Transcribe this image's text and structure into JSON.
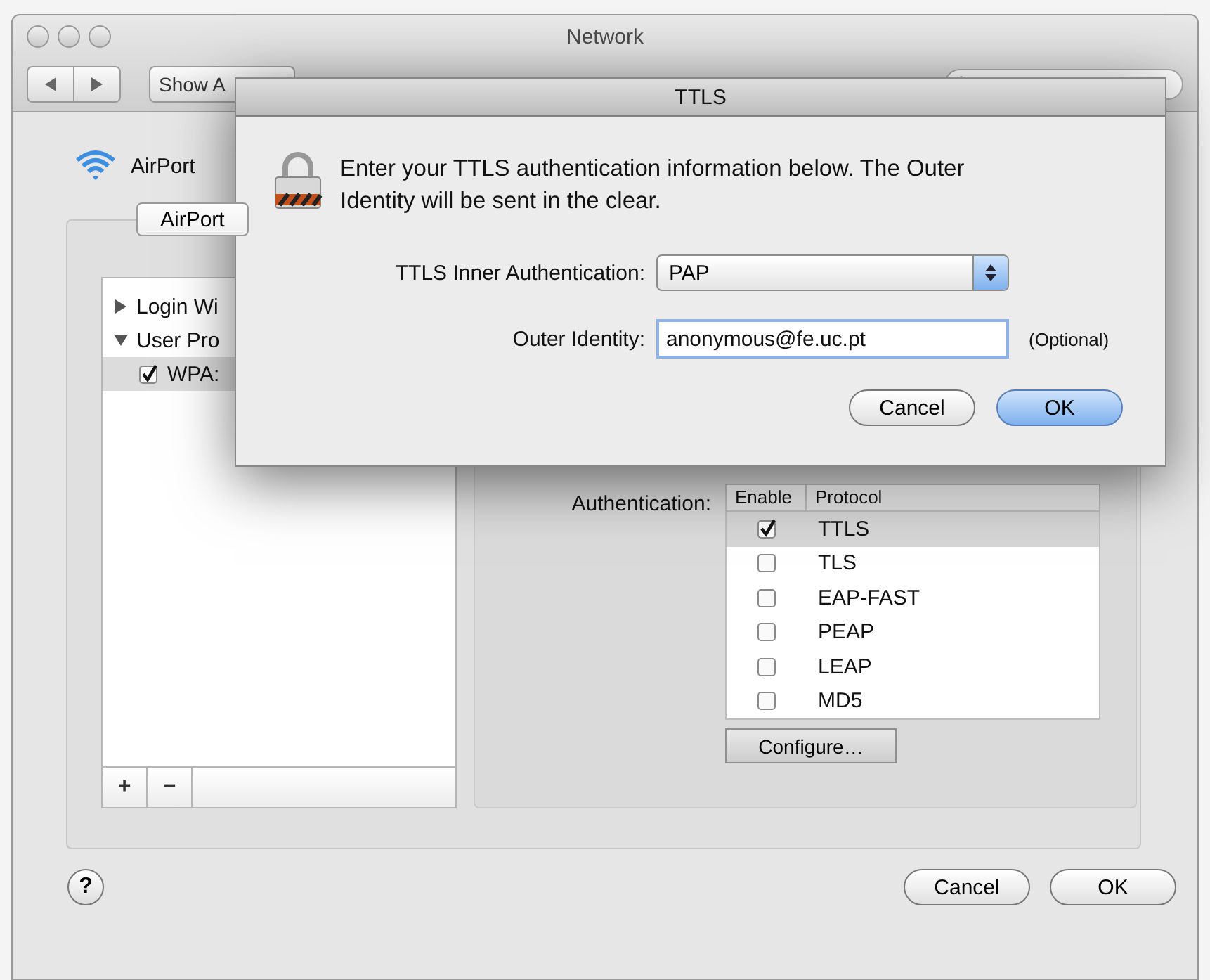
{
  "window": {
    "title": "Network"
  },
  "toolbar": {
    "show_all_button": "Show A"
  },
  "sheet": {
    "service": "AirPort",
    "tabs": [
      {
        "label": "AirPort",
        "selected": true
      }
    ],
    "profiles": [
      {
        "label": "Login Wi",
        "expanded": false
      },
      {
        "label": "User Pro",
        "expanded": true,
        "children": [
          {
            "label": "WPA:",
            "checked": true,
            "selected": true
          }
        ]
      }
    ],
    "list_buttons": [
      "+",
      "−"
    ],
    "authentication": {
      "label": "Authentication:",
      "columns": [
        "Enable",
        "Protocol"
      ],
      "rows": [
        {
          "protocol": "TTLS",
          "checked": true,
          "selected": true
        },
        {
          "protocol": "TLS",
          "checked": false,
          "selected": false
        },
        {
          "protocol": "EAP-FAST",
          "checked": false,
          "selected": false
        },
        {
          "protocol": "PEAP",
          "checked": false,
          "selected": false
        },
        {
          "protocol": "LEAP",
          "checked": false,
          "selected": false
        },
        {
          "protocol": "MD5",
          "checked": false,
          "selected": false
        }
      ]
    },
    "configure_button": "Configure…",
    "help_button": "?",
    "buttons": [
      {
        "label": "Cancel",
        "default": false
      },
      {
        "label": "OK",
        "default": false
      }
    ]
  },
  "dialog": {
    "title": "TTLS",
    "message": "Enter your TTLS authentication information below. The Outer Identity will be sent in the clear.",
    "inner_auth": {
      "label": "TTLS Inner Authentication:",
      "value": "PAP"
    },
    "outer_identity": {
      "label": "Outer Identity:",
      "value": "anonymous@fe.uc.pt",
      "note": "(Optional)"
    },
    "buttons": [
      {
        "label": "Cancel",
        "default": false
      },
      {
        "label": "OK",
        "default": true
      }
    ]
  }
}
